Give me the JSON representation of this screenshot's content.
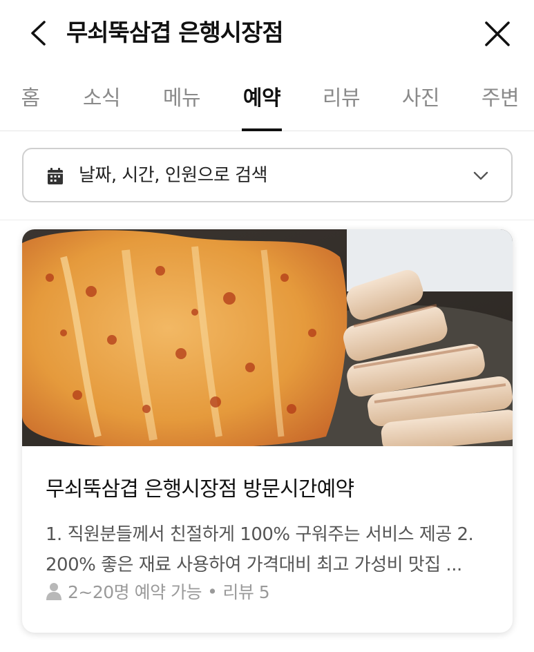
{
  "header": {
    "title": "무쇠뚝삼겹 은행시장점",
    "back_icon": "chevron-left-icon",
    "close_icon": "close-icon"
  },
  "tabs": [
    {
      "label": "홈",
      "active": false
    },
    {
      "label": "소식",
      "active": false
    },
    {
      "label": "메뉴",
      "active": false
    },
    {
      "label": "예약",
      "active": true
    },
    {
      "label": "리뷰",
      "active": false
    },
    {
      "label": "사진",
      "active": false
    },
    {
      "label": "주변",
      "active": false
    }
  ],
  "search": {
    "icon": "calendar-icon",
    "text": "날짜, 시간, 인원으로 검색",
    "dropdown_icon": "chevron-down-icon"
  },
  "card": {
    "image": "kimchi-and-pork-belly-grill-photo",
    "title": "무쇠뚝삼겹 은행시장점 방문시간예약",
    "desc_line1": "1. 직원분들께서 친절하게 100% 구워주는 서비스 제공 2.",
    "desc_line2": "200% 좋은 재료 사용하여 가격대비 최고 가성비 맛집 ...",
    "meta_icon": "person-icon",
    "capacity": "2~20명 예약 가능",
    "separator": "•",
    "reviews": "리뷰 5"
  },
  "colors": {
    "active_tab": "#111111",
    "inactive_tab": "#8a8a8a",
    "border": "#cfcfcf",
    "meta_text": "#9a9a9a"
  }
}
